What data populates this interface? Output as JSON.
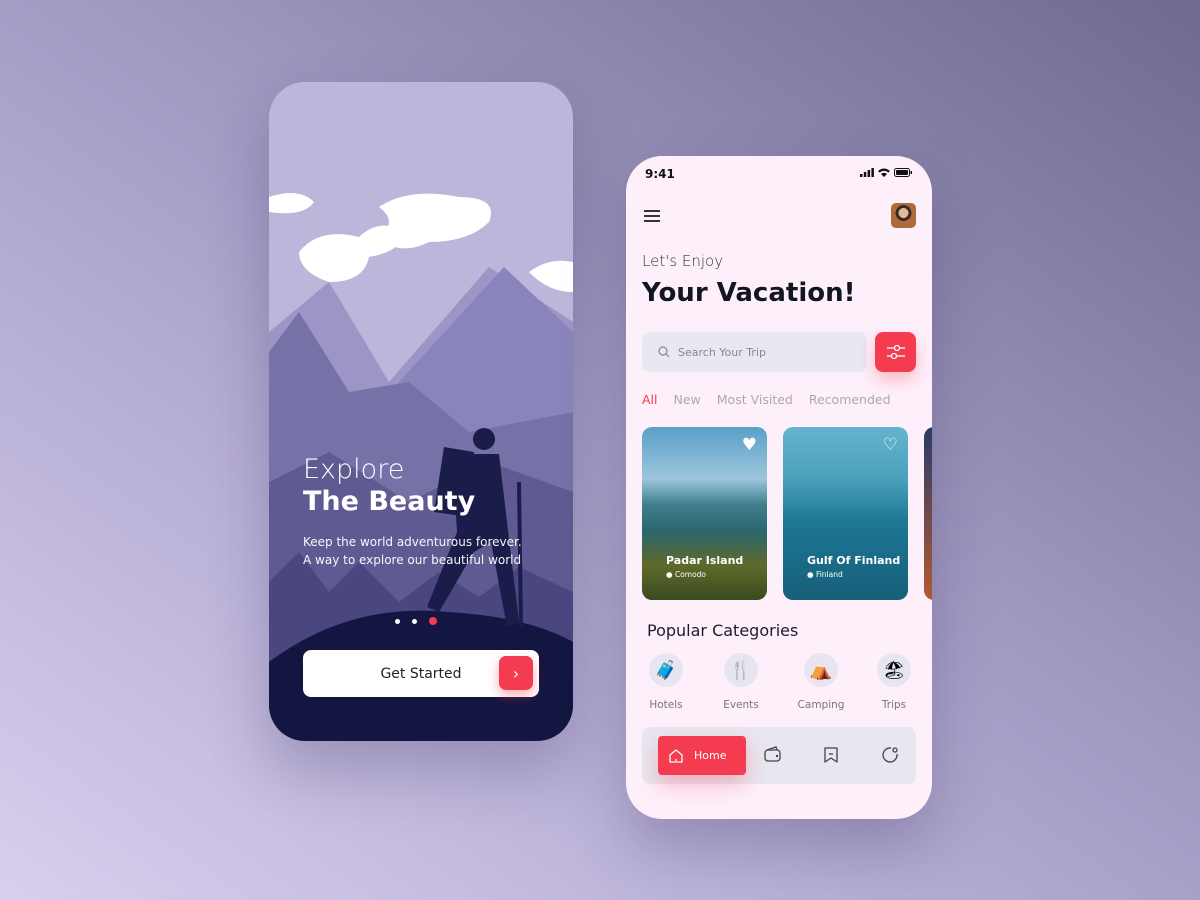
{
  "onboarding": {
    "title_line1": "Explore",
    "title_line2": "The Beauty",
    "subtitle_line1": "Keep the world adventurous forever.",
    "subtitle_line2": "A way to explore our beautiful world",
    "pager": {
      "count": 3,
      "active": 3
    },
    "cta_label": "Get Started",
    "cta_icon": "chevron-right-icon"
  },
  "home": {
    "status": {
      "time": "9:41"
    },
    "greeting": "Let's Enjoy",
    "headline": "Your Vacation!",
    "search": {
      "placeholder": "Search Your Trip"
    },
    "tabs": [
      {
        "label": "All",
        "active": true
      },
      {
        "label": "New"
      },
      {
        "label": "Most Visited"
      },
      {
        "label": "Recomended"
      }
    ],
    "places": [
      {
        "name": "Padar Island",
        "location": "Comodo"
      },
      {
        "name": "Gulf Of Finland",
        "location": "Finland"
      }
    ],
    "categories_title": "Popular Categories",
    "categories": [
      {
        "label": "Hotels",
        "icon": "suitcase-icon"
      },
      {
        "label": "Events",
        "icon": "cutlery-icon"
      },
      {
        "label": "Camping",
        "icon": "tent-icon"
      },
      {
        "label": "Trips",
        "icon": "beach-icon"
      }
    ],
    "nav": {
      "home_label": "Home",
      "items": [
        "wallet-icon",
        "bookmark-icon",
        "profile-icon"
      ]
    }
  },
  "colors": {
    "accent": "#f53b4f",
    "dark": "#121620",
    "bg": "#fdf0fb"
  }
}
